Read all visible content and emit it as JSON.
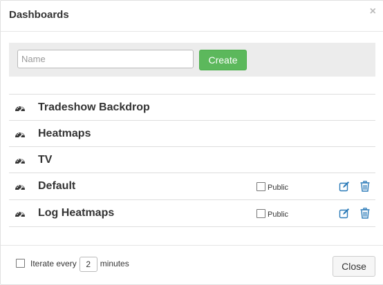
{
  "modal": {
    "title": "Dashboards",
    "close_glyph": "×"
  },
  "create": {
    "name_placeholder": "Name",
    "name_value": "",
    "create_label": "Create"
  },
  "dashboards": [
    {
      "name": "Tradeshow Backdrop",
      "icon": "dashboard-icon"
    },
    {
      "name": "Heatmaps",
      "icon": "dashboard-icon"
    },
    {
      "name": "TV",
      "icon": "dashboard-icon"
    },
    {
      "name": "Default",
      "icon": "dashboard-icon",
      "public_label": "Public",
      "public_checked": false,
      "editable": true
    },
    {
      "name": "Log Heatmaps",
      "icon": "dashboard-icon",
      "public_label": "Public",
      "public_checked": false,
      "editable": true
    }
  ],
  "footer": {
    "iterate_checked": false,
    "iterate_prefix": "Iterate every",
    "iterate_value": "2",
    "iterate_suffix": "minutes",
    "close_label": "Close"
  },
  "colors": {
    "create_button": "#5cb85c",
    "action_icon": "#2a7ab8",
    "dashboard_icon": "#333333"
  }
}
